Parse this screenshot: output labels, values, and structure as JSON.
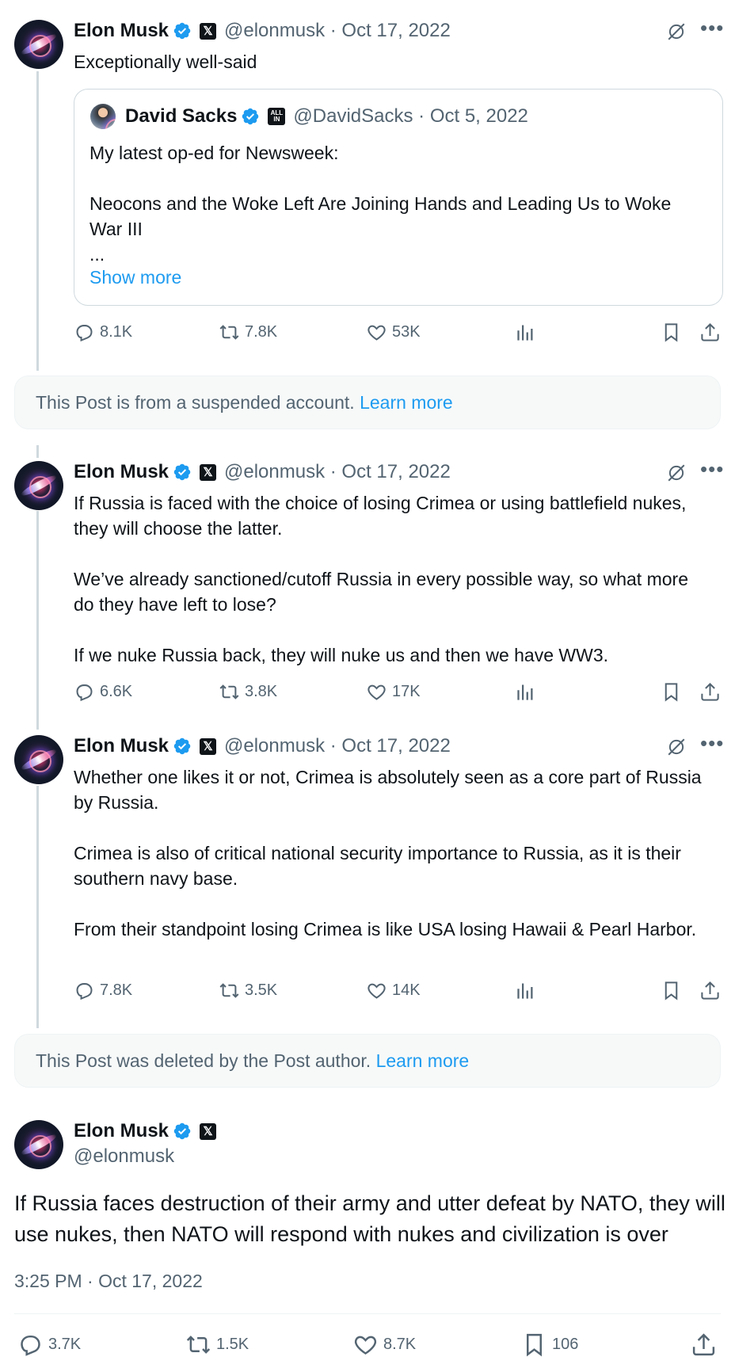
{
  "posts": [
    {
      "name": "Elon Musk",
      "handle": "@elonmusk",
      "date": "Oct 17, 2022",
      "text": "Exceptionally well-said",
      "quote": {
        "name": "David Sacks",
        "handle": "@DavidSacks",
        "date": "Oct 5, 2022",
        "text": "My latest op-ed for Newsweek:\n\nNeocons and the Woke Left Are Joining Hands and Leading Us to Woke War III\n...",
        "show_more": "Show more"
      },
      "replies": "8.1K",
      "reposts": "7.8K",
      "likes": "53K"
    },
    {
      "name": "Elon Musk",
      "handle": "@elonmusk",
      "date": "Oct 17, 2022",
      "text": "If Russia is faced with the choice of losing Crimea or using battlefield nukes, they will choose the latter.\n\nWe’ve already sanctioned/cutoff Russia in every possible way, so what more do they have left to lose?\n\nIf we nuke Russia back, they will nuke us and then we have WW3.",
      "replies": "6.6K",
      "reposts": "3.8K",
      "likes": "17K"
    },
    {
      "name": "Elon Musk",
      "handle": "@elonmusk",
      "date": "Oct 17, 2022",
      "text": "Whether one likes it or not, Crimea is absolutely seen as a core part of Russia by Russia.\n\nCrimea is also of critical national security importance to Russia, as it is their southern navy base.\n\nFrom their standpoint losing Crimea is like USA losing Hawaii & Pearl Harbor.",
      "replies": "7.8K",
      "reposts": "3.5K",
      "likes": "14K"
    }
  ],
  "notices": [
    {
      "text": "This Post is from a suspended account. ",
      "link": "Learn more"
    },
    {
      "text": "This Post was deleted by the Post author. ",
      "link": "Learn more"
    }
  ],
  "main_post": {
    "name": "Elon Musk",
    "handle": "@elonmusk",
    "text": "If Russia faces destruction of their army and utter defeat by NATO, they will use nukes, then NATO will respond with nukes and civilization is over",
    "timestamp": "3:25 PM · Oct 17, 2022",
    "replies": "3.7K",
    "reposts": "1.5K",
    "likes": "8.7K",
    "bookmarks": "106"
  },
  "separator": " · ",
  "icons": [
    "verified-badge-icon",
    "x-affiliate-icon",
    "grok-icon",
    "more-icon",
    "reply-icon",
    "repost-icon",
    "like-icon",
    "views-icon",
    "bookmark-icon",
    "share-icon"
  ],
  "colors": {
    "accent": "#1d9bf0",
    "muted": "#536471",
    "text": "#0f1419",
    "verified": "#1d9bf0"
  }
}
